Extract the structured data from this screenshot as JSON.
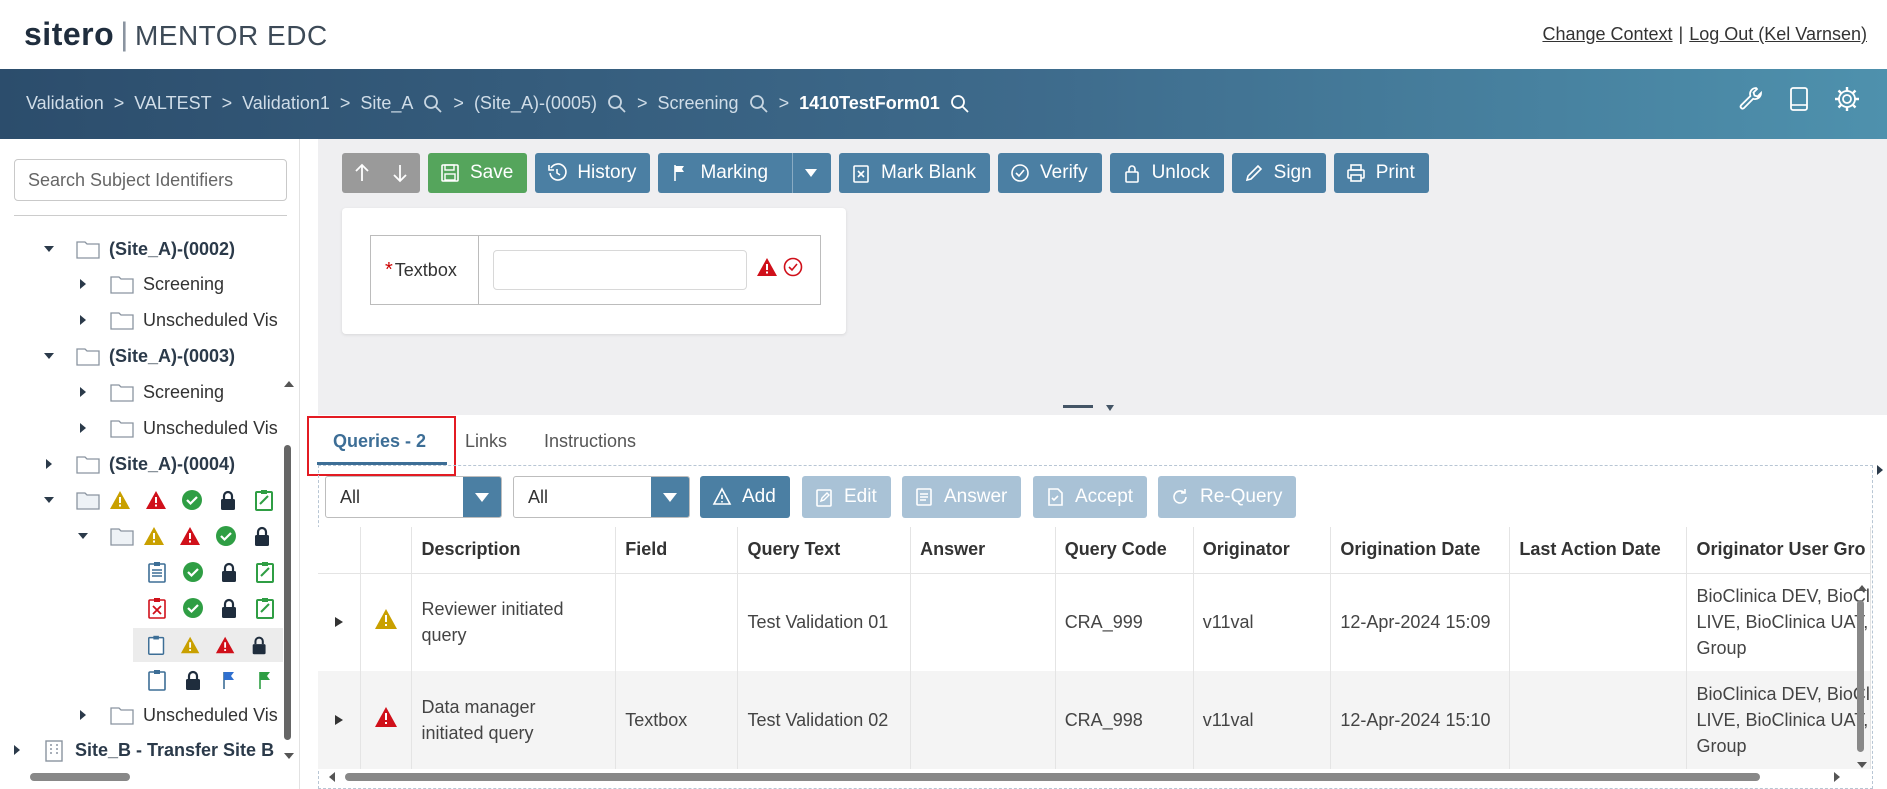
{
  "header": {
    "brand": "sitero",
    "product": "MENTOR EDC",
    "links": {
      "change_context": "Change Context",
      "separator": "|",
      "logout": "Log Out (Kel Varnsen)"
    }
  },
  "breadcrumb": {
    "items": [
      "Validation",
      "VALTEST",
      "Validation1",
      "Site_A",
      "(Site_A)-(0005)",
      "Screening",
      "1410TestForm01"
    ],
    "separator": ">"
  },
  "header_icons": [
    "wrench-icon",
    "tablet-icon",
    "gear-icon"
  ],
  "sidebar": {
    "search_placeholder": "Search Subject Identifiers",
    "tree": [
      {
        "label": "(Site_A)-(0002)",
        "bold": true
      },
      {
        "label": "Screening"
      },
      {
        "label": "Unscheduled Vis"
      },
      {
        "label": "(Site_A)-(0003)",
        "bold": true
      },
      {
        "label": "Screening"
      },
      {
        "label": "Unscheduled Vis"
      },
      {
        "label": "(Site_A)-(0004)",
        "bold": true
      },
      {
        "label": "Unscheduled Vis"
      },
      {
        "label": "Site_B - Transfer Site B",
        "bold": true
      }
    ]
  },
  "toolbar": {
    "save": "Save",
    "history": "History",
    "marking": "Marking",
    "mark_blank": "Mark Blank",
    "verify": "Verify",
    "unlock": "Unlock",
    "sign": "Sign",
    "print": "Print"
  },
  "form": {
    "required_marker": "*",
    "field_label": "Textbox",
    "field_value": ""
  },
  "tabs": {
    "queries": "Queries - 2",
    "links": "Links",
    "instructions": "Instructions"
  },
  "queries_toolbar": {
    "filter1": "All",
    "filter2": "All",
    "add": "Add",
    "edit": "Edit",
    "answer": "Answer",
    "accept": "Accept",
    "requery": "Re-Query"
  },
  "grid": {
    "columns": [
      "Description",
      "Field",
      "Query Text",
      "Answer",
      "Query Code",
      "Originator",
      "Origination Date",
      "Last Action Date",
      "Originator User Gro"
    ],
    "rows": [
      {
        "description_1": "Reviewer initiated",
        "description_2": "query",
        "field": "",
        "query_text": "Test Validation 01",
        "answer": "",
        "query_code": "CRA_999",
        "originator": "v11val",
        "origination_date": "12-Apr-2024 15:09",
        "last_action_date": "",
        "group_1": "BioClinica DEV, BioCl",
        "group_2": "LIVE, BioClinica UAT,",
        "group_3": "Group",
        "severity": "warning",
        "severity_color": "#c9a000"
      },
      {
        "description_1": "Data manager",
        "description_2": "initiated query",
        "field": "Textbox",
        "query_text": "Test Validation 02",
        "answer": "",
        "query_code": "CRA_998",
        "originator": "v11val",
        "origination_date": "12-Apr-2024 15:10",
        "last_action_date": "",
        "group_1": "BioClinica DEV, BioCl",
        "group_2": "LIVE, BioClinica UAT,",
        "group_3": "Group",
        "severity": "error",
        "severity_color": "#d0101a"
      }
    ]
  },
  "colors": {
    "primary_button": "#4b7fa3",
    "save_button": "#55a55c",
    "highlight_box": "#e31b23",
    "warning": "#c9a000",
    "error": "#d0101a",
    "ok": "#2f9e44"
  }
}
